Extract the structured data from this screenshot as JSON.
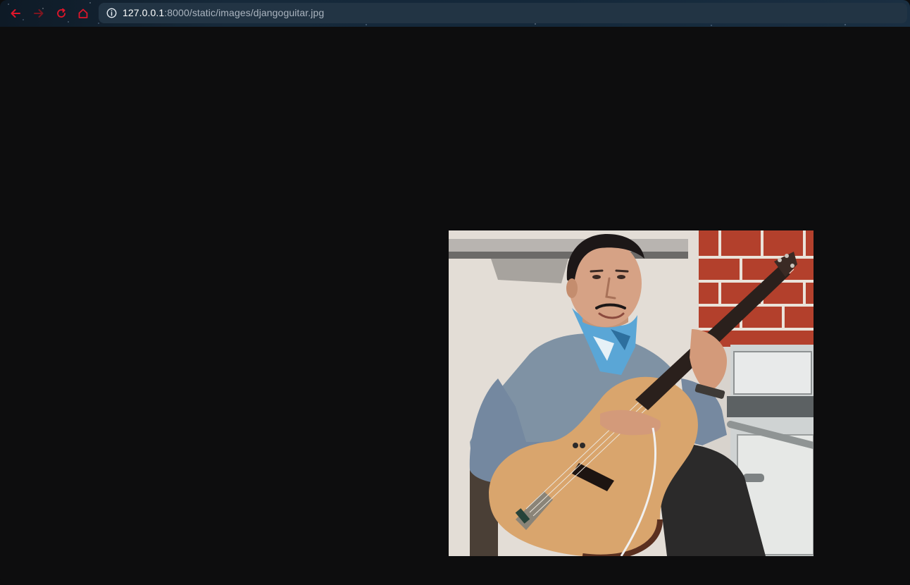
{
  "browser": {
    "nav": {
      "back_icon": "arrow-left-icon",
      "forward_icon": "arrow-right-icon",
      "reload_icon": "reload-icon",
      "home_icon": "home-icon"
    },
    "urlbar": {
      "info_icon": "info-circle-icon",
      "host": "127.0.0.1",
      "rest": ":8000/static/images/djangoguitar.jpg"
    },
    "colors": {
      "toolbar": "#16293a",
      "urlbar": "#223444",
      "accent_icons": "#e0162b",
      "page_background": "#0d0d0e"
    }
  },
  "image": {
    "description_icon": "photo-of-guitarist"
  }
}
